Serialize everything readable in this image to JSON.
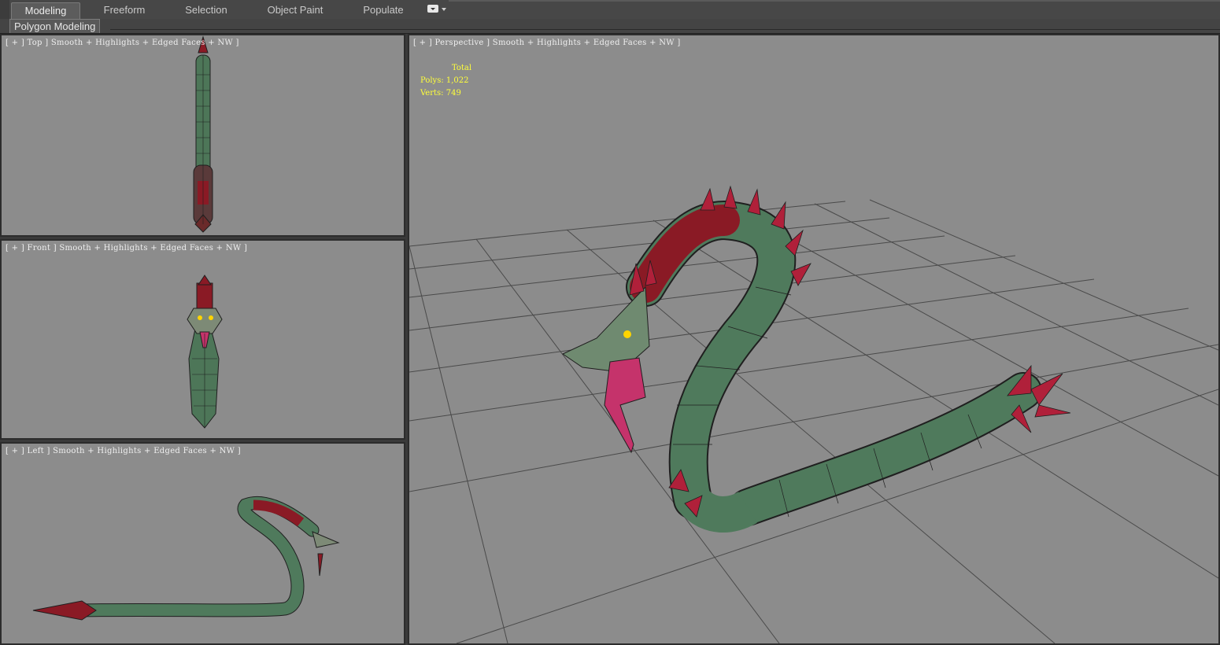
{
  "ribbon": {
    "tabs": [
      {
        "label": "Modeling",
        "active": true
      },
      {
        "label": "Freeform",
        "active": false
      },
      {
        "label": "Selection",
        "active": false
      },
      {
        "label": "Object Paint",
        "active": false
      },
      {
        "label": "Populate",
        "active": false
      }
    ],
    "menu_icon": "dropdown-box-icon",
    "panel_label": "Polygon Modeling"
  },
  "viewports": {
    "top": {
      "label": "[ + ] Top ] Smooth + Highlights + Edged Faces + NW ]"
    },
    "front": {
      "label": "[ + ] Front ] Smooth + Highlights + Edged Faces + NW ]"
    },
    "left": {
      "label": "[ + ] Left ] Smooth + Highlights + Edged Faces + NW ]"
    },
    "perspective": {
      "label": "[ + ] Perspective ] Smooth + Highlights + Edged Faces + NW ]",
      "stats": {
        "total_label": "Total",
        "polys_label": "Polys:",
        "polys_value": "1,022",
        "verts_label": "Verts:",
        "verts_value": "749"
      }
    }
  },
  "colors": {
    "viewport_bg": "#8c8c8c",
    "grid_line": "#4a4a4a",
    "stats_text": "#ffff3a",
    "serpent_body": "#4f7a5c",
    "serpent_spikes": "#b0203a",
    "serpent_eye": "#ffd400"
  }
}
